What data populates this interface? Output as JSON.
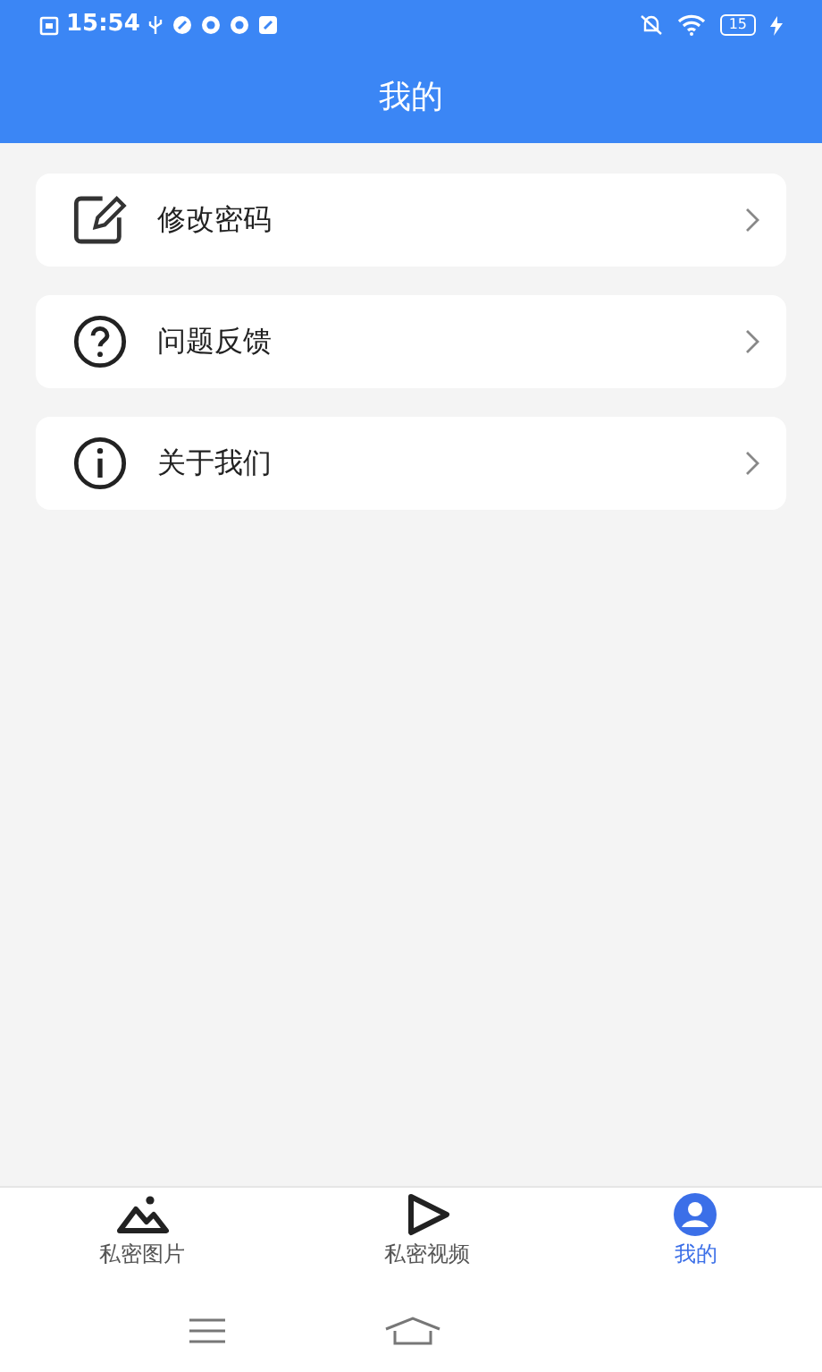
{
  "status_bar": {
    "time": "15:54",
    "battery": "15"
  },
  "header": {
    "title": "我的"
  },
  "menu": [
    {
      "kind": "edit",
      "label": "修改密码"
    },
    {
      "kind": "help",
      "label": "问题反馈"
    },
    {
      "kind": "info",
      "label": "关于我们"
    }
  ],
  "bottom_nav": [
    {
      "kind": "pictures",
      "label": "私密图片",
      "selected": false
    },
    {
      "kind": "videos",
      "label": "私密视频",
      "selected": false
    },
    {
      "kind": "profile",
      "label": "我的",
      "selected": true
    }
  ],
  "system_nav": [
    {
      "kind": "menu"
    },
    {
      "kind": "home"
    }
  ]
}
